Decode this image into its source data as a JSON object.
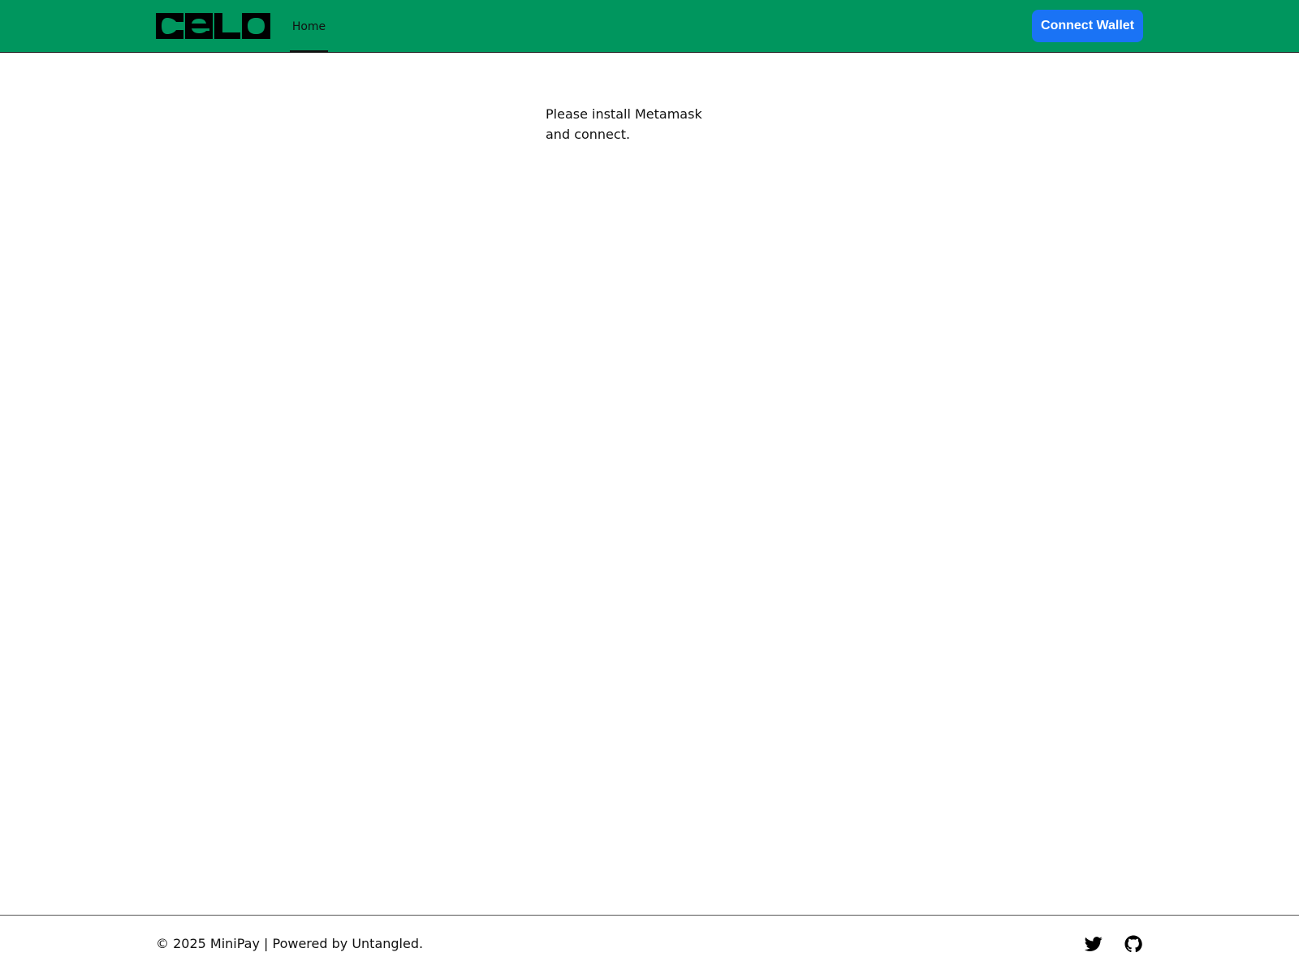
{
  "header": {
    "logo_text": "celo",
    "nav": [
      {
        "label": "Home",
        "active": true
      }
    ],
    "connect_button_label": "Connect Wallet",
    "background_color": "#00965e",
    "button_color": "#1a73f5"
  },
  "main": {
    "message": "Please install Metamask and connect."
  },
  "footer": {
    "text": "© 2025 MiniPay | Powered by Untangled.",
    "social_icons": [
      "twitter-icon",
      "github-icon"
    ]
  }
}
